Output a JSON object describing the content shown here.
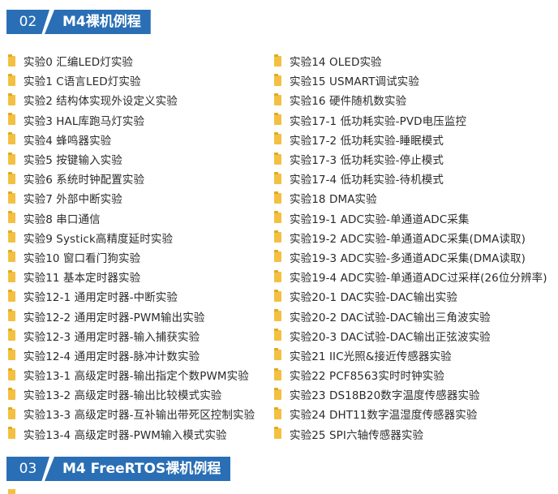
{
  "sections": [
    {
      "number": "02",
      "title": "M4裸机例程"
    },
    {
      "number": "03",
      "title": "M4 FreeRTOS裸机例程"
    }
  ],
  "left_items": [
    "实验0 汇编LED灯实验",
    "实验1 C语言LED灯实验",
    "实验2 结构体实现外设定义实验",
    "实验3 HAL库跑马灯实验",
    "实验4 蜂鸣器实验",
    "实验5 按键输入实验",
    "实验6 系统时钟配置实验",
    "实验7 外部中断实验",
    "实验8 串口通信",
    "实验9 Systick高精度延时实验",
    "实验10 窗口看门狗实验",
    "实验11 基本定时器实验",
    "实验12-1 通用定时器-中断实验",
    "实验12-2 通用定时器-PWM输出实验",
    "实验12-3 通用定时器-输入捕获实验",
    "实验12-4 通用定时器-脉冲计数实验",
    "实验13-1 高级定时器-输出指定个数PWM实验",
    "实验13-2 高级定时器-输出比较模式实验",
    "实验13-3 高级定时器-互补输出带死区控制实验",
    "实验13-4 高级定时器-PWM输入模式实验"
  ],
  "right_items": [
    "实验14 OLED实验",
    "实验15 USMART调试实验",
    "实验16 硬件随机数实验",
    "实验17-1 低功耗实验-PVD电压监控",
    "实验17-2 低功耗实验-睡眠模式",
    "实验17-3 低功耗实验-停止模式",
    "实验17-4 低功耗实验-待机模式",
    "实验18 DMA实验",
    "实验19-1 ADC实验-单通道ADC采集",
    "实验19-2 ADC实验-单通道ADC采集(DMA读取)",
    "实验19-3 ADC实验-多通道ADC采集(DMA读取)",
    "实验19-4 ADC实验-单通道ADC过采样(26位分辨率)",
    "实验20-1 DAC实验-DAC输出实验",
    "实验20-2 DAC试验-DAC输出三角波实验",
    "实验20-3 DAC试验-DAC输出正弦波实验",
    "实验21 IIC光照&接近传感器实验",
    "实验22 PCF8563实时时钟实验",
    "实验23 DS18B20数字温度传感器实验",
    "实验24 DHT11数字温湿度传感器实验",
    "实验25 SPI六轴传感器实验"
  ],
  "icon": "folder-icon",
  "colors": {
    "header_bg": "#2a6fb5",
    "folder": "#f4c042",
    "text": "#2b2b2b"
  }
}
